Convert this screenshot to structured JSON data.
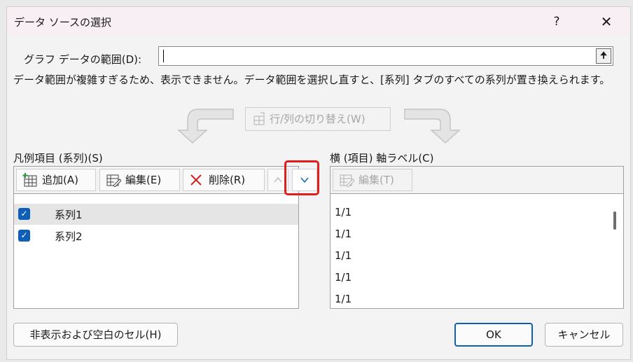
{
  "window": {
    "title": "データ ソースの選択",
    "help_label": "?",
    "close_label": "✕"
  },
  "range": {
    "label": "グラフ データの範囲(D):",
    "value": "",
    "collapse_icon": "upload-arrow-icon"
  },
  "message": "データ範囲が複雑すぎるため、表示できません。データ範囲を選択し直すと、[系列] タブのすべての系列が置き換えられます。",
  "switch_button": {
    "label": "行/列の切り替え(W)",
    "enabled": false
  },
  "legend": {
    "label": "凡例項目 (系列)(S)",
    "buttons": {
      "add": "追加(A)",
      "edit": "編集(E)",
      "delete": "削除(R)",
      "up_icon": "chevron-up-icon",
      "down_icon": "chevron-down-icon"
    },
    "series": [
      {
        "name": "系列1",
        "checked": true,
        "selected": true
      },
      {
        "name": "系列2",
        "checked": true,
        "selected": false
      }
    ]
  },
  "axis": {
    "label": "横 (項目) 軸ラベル(C)",
    "edit_label": "編集(T)",
    "items": [
      "1/1",
      "1/1",
      "1/1",
      "1/1",
      "1/1"
    ]
  },
  "footer": {
    "hidden_cells": "非表示および空白のセル(H)",
    "ok": "OK",
    "cancel": "キャンセル"
  },
  "colors": {
    "accent": "#0f5fb7",
    "highlight": "#e01e1e",
    "titlebar": "#f7eff3"
  }
}
